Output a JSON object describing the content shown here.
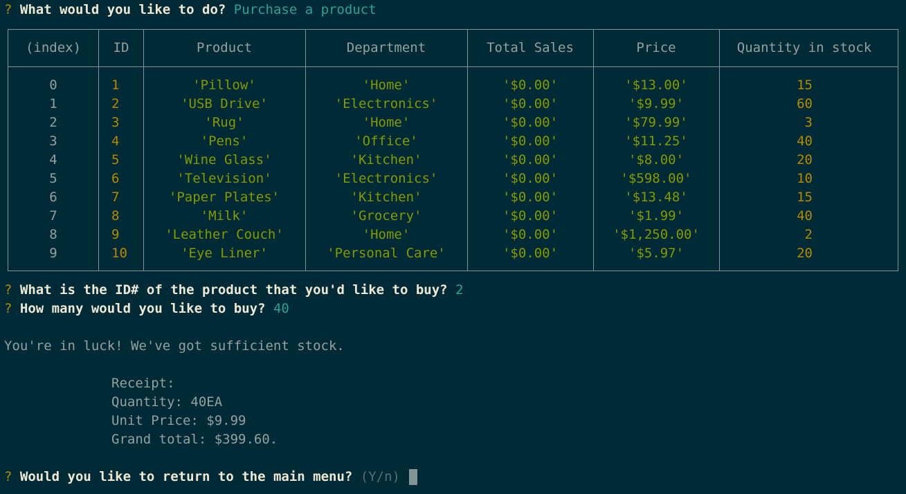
{
  "prompt_symbol": "?",
  "q1": {
    "text": "What would you like to do?",
    "answer": "Purchase a product"
  },
  "table": {
    "headers": [
      "(index)",
      "ID",
      "Product",
      "Department",
      "Total Sales",
      "Price",
      "Quantity in stock"
    ],
    "rows": [
      [
        "0",
        "1",
        "'Pillow'",
        "'Home'",
        "'$0.00'",
        "'$13.00'",
        "15"
      ],
      [
        "1",
        "2",
        "'USB Drive'",
        "'Electronics'",
        "'$0.00'",
        "'$9.99'",
        "60"
      ],
      [
        "2",
        "3",
        "'Rug'",
        "'Home'",
        "'$0.00'",
        "'$79.99'",
        "3"
      ],
      [
        "3",
        "4",
        "'Pens'",
        "'Office'",
        "'$0.00'",
        "'$11.25'",
        "40"
      ],
      [
        "4",
        "5",
        "'Wine Glass'",
        "'Kitchen'",
        "'$0.00'",
        "'$8.00'",
        "20"
      ],
      [
        "5",
        "6",
        "'Television'",
        "'Electronics'",
        "'$0.00'",
        "'$598.00'",
        "10"
      ],
      [
        "6",
        "7",
        "'Paper Plates'",
        "'Kitchen'",
        "'$0.00'",
        "'$13.48'",
        "15"
      ],
      [
        "7",
        "8",
        "'Milk'",
        "'Grocery'",
        "'$0.00'",
        "'$1.99'",
        "40"
      ],
      [
        "8",
        "9",
        "'Leather Couch'",
        "'Home'",
        "'$0.00'",
        "'$1,250.00'",
        "2"
      ],
      [
        "9",
        "10",
        "'Eye Liner'",
        "'Personal Care'",
        "'$0.00'",
        "'$5.97'",
        "20"
      ]
    ]
  },
  "q2": {
    "text": "What is the ID# of the product that you'd like to buy?",
    "answer": "2"
  },
  "q3": {
    "text": "How many would you like to buy?",
    "answer": "40"
  },
  "message": "You're in luck! We've got sufficient stock.",
  "receipt": {
    "title": "Receipt:",
    "quantity": "Quantity: 40EA",
    "unit_price": "Unit Price: $9.99",
    "grand_total": "Grand total: $399.60."
  },
  "q4": {
    "text": "Would you like to return to the main menu?",
    "hint": "(Y/n)"
  },
  "colors": {
    "background": "#002b36",
    "prompt": "#b58900",
    "answer": "#2aa198",
    "string_value": "#859900",
    "number_value": "#b58900"
  }
}
